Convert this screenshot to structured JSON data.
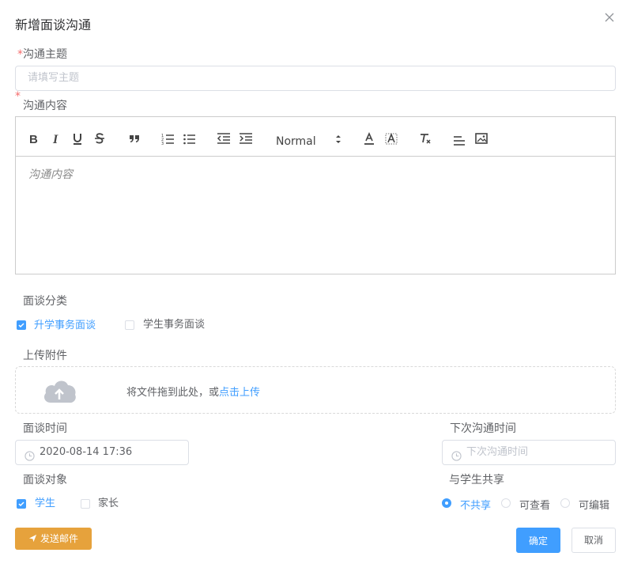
{
  "dialog": {
    "title": "新增面谈沟通"
  },
  "form": {
    "topic_label": "沟通主题",
    "topic_placeholder": "请填写主题",
    "content_label": "沟通内容",
    "content_placeholder": "沟通内容",
    "required_mark": "*"
  },
  "toolbar": {
    "header_select": "Normal"
  },
  "category": {
    "label": "面谈分类",
    "options": [
      {
        "label": "升学事务面谈",
        "checked": true
      },
      {
        "label": "学生事务面谈",
        "checked": false
      }
    ]
  },
  "upload": {
    "label": "上传附件",
    "text": "将文件拖到此处，或",
    "link": "点击上传"
  },
  "time": {
    "label": "面谈时间",
    "value": "2020-08-14 17:36"
  },
  "next_time": {
    "label": "下次沟通时间",
    "placeholder": "下次沟通时间"
  },
  "target": {
    "label": "面谈对象",
    "options": [
      {
        "label": "学生",
        "checked": true
      },
      {
        "label": "家长",
        "checked": false
      }
    ]
  },
  "share": {
    "label": "与学生共享",
    "options": [
      {
        "label": "不共享",
        "selected": true
      },
      {
        "label": "可查看",
        "selected": false
      },
      {
        "label": "可编辑",
        "selected": false
      }
    ]
  },
  "buttons": {
    "send_mail": "发送邮件",
    "confirm": "确定",
    "cancel": "取消"
  },
  "colors": {
    "primary": "#409eff",
    "warning": "#e6a23c",
    "danger": "#f56c6c"
  }
}
